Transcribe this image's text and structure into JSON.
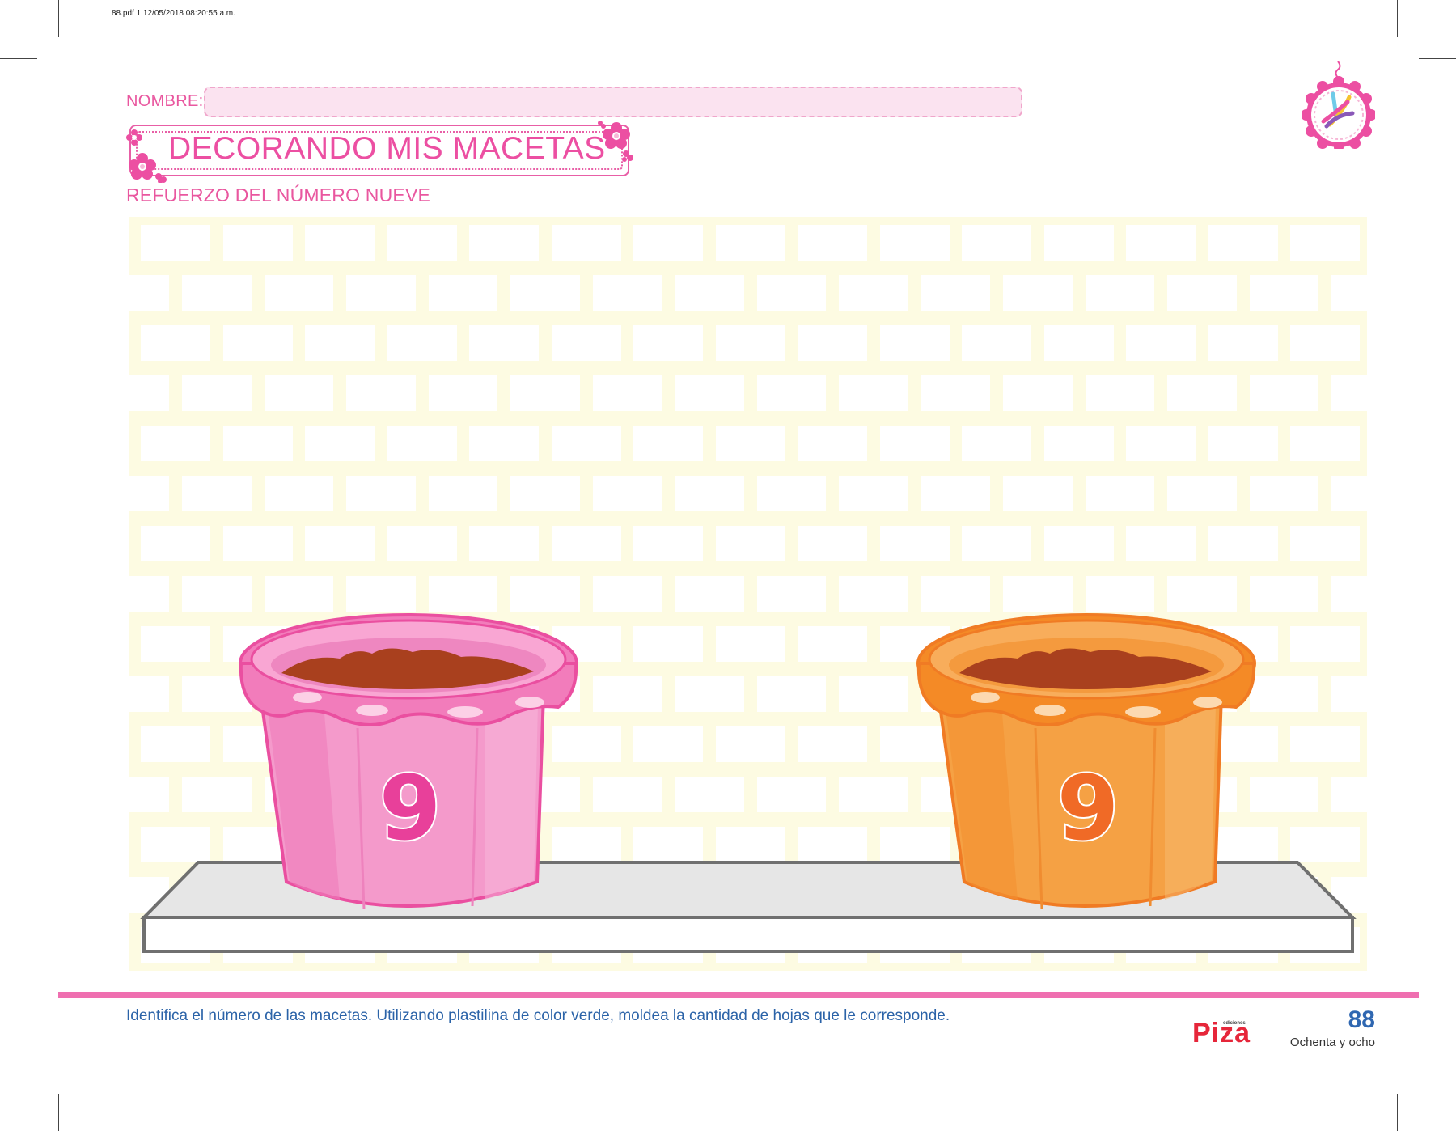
{
  "print_info": "88.pdf   1   12/05/2018   08:20:55 a.m.",
  "header": {
    "nombre_label": "NOMBRE:",
    "title": "DECORANDO MIS MACETAS",
    "subtitle": "REFUERZO DEL NÚMERO NUEVE"
  },
  "pots": [
    {
      "number": "9",
      "color": "#f48fc6"
    },
    {
      "number": "9",
      "color": "#f5a144"
    }
  ],
  "footer": {
    "instruction": "Identifica el número de las macetas. Utilizando plastilina de color verde, moldea la cantidad de hojas que le corresponde.",
    "publisher": "Piza",
    "publisher_small": "ediciones",
    "page_number": "88",
    "page_words": "Ochenta y ocho"
  },
  "colors": {
    "accent_pink": "#ec4fa2",
    "footer_blue": "#2b63a8",
    "brick_wall": "#fdfbe2"
  }
}
